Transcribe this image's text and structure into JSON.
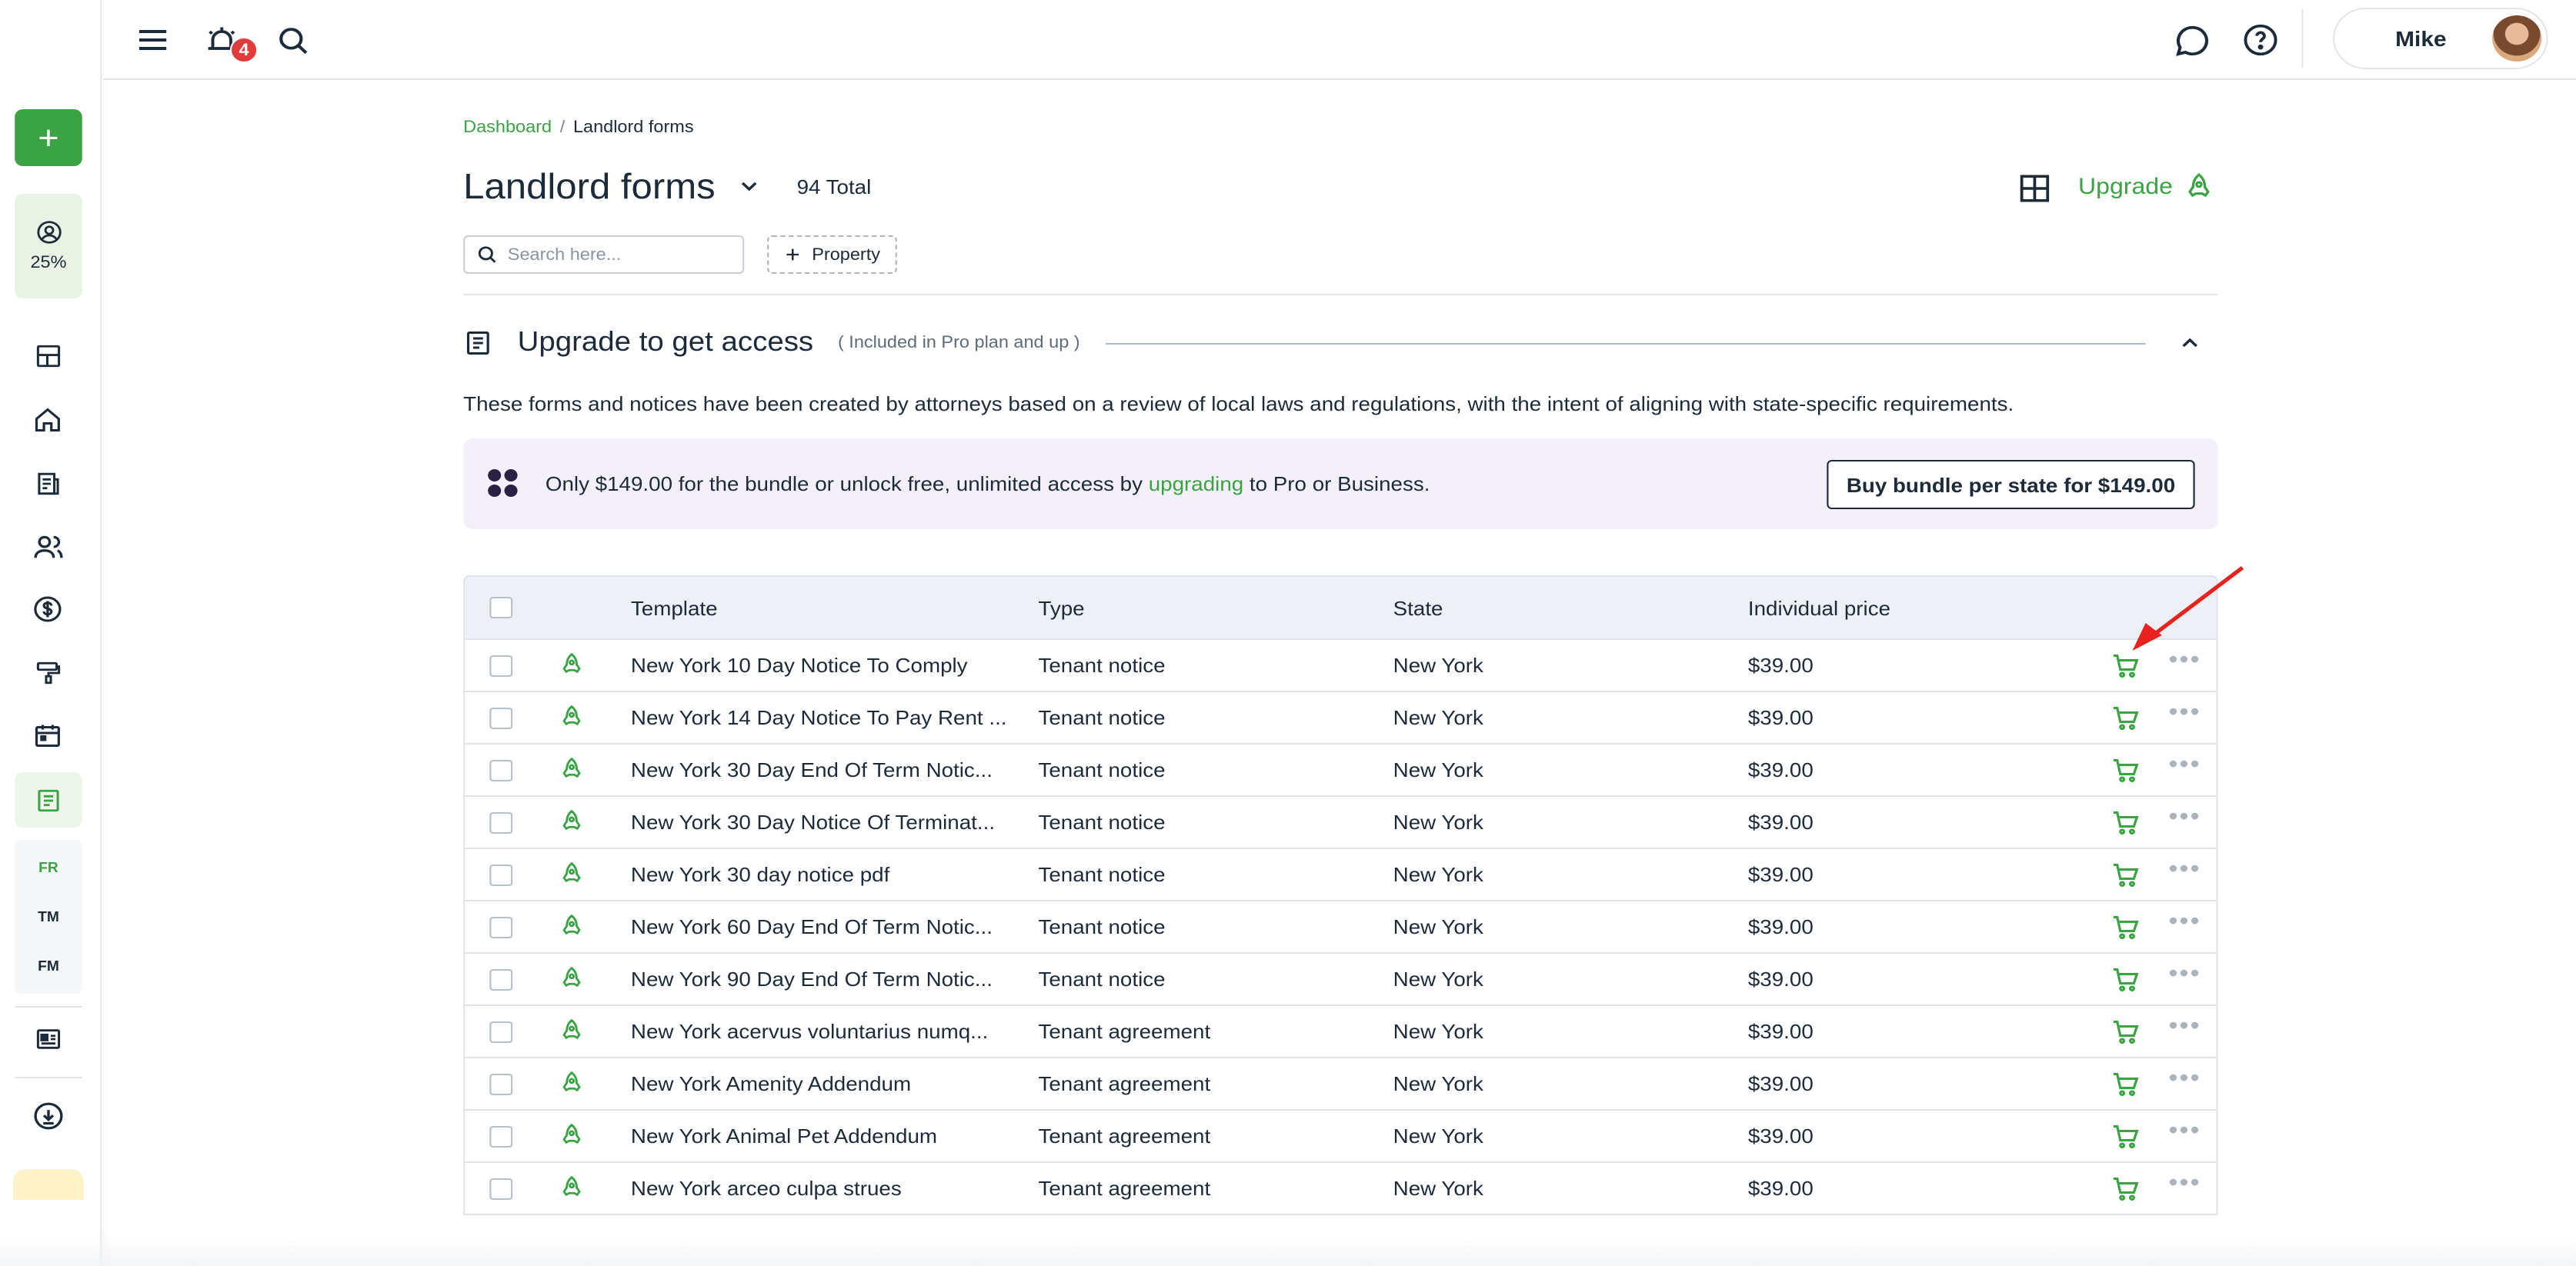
{
  "sidebar": {
    "add_label": "+",
    "progress": "25%",
    "letters": [
      "FR",
      "TM",
      "FM"
    ]
  },
  "topbar": {
    "notification_count": "4",
    "user_name": "Mike"
  },
  "breadcrumb": {
    "home": "Dashboard",
    "sep": "/",
    "current": "Landlord forms"
  },
  "header": {
    "title": "Landlord forms",
    "total": "94 Total",
    "upgrade_label": "Upgrade"
  },
  "filters": {
    "search_placeholder": "Search here...",
    "property_label": "Property"
  },
  "upgrade_section": {
    "title": "Upgrade to get access",
    "subtitle": "( Included in Pro plan and up )",
    "description": "These forms and notices have been created by attorneys based on a review of local laws and regulations, with the intent of aligning with state-specific requirements.",
    "promo_before": "Only $149.00 for the bundle or unlock free, unlimited access by ",
    "promo_link": "upgrading",
    "promo_after": " to Pro or Business.",
    "bundle_button": "Buy bundle per state for $149.00"
  },
  "table": {
    "headers": {
      "template": "Template",
      "type": "Type",
      "state": "State",
      "price": "Individual price"
    },
    "rows": [
      {
        "template": "New York 10 Day Notice To Comply",
        "type": "Tenant notice",
        "state": "New York",
        "price": "$39.00"
      },
      {
        "template": "New York 14 Day Notice To Pay Rent ...",
        "type": "Tenant notice",
        "state": "New York",
        "price": "$39.00"
      },
      {
        "template": "New York 30 Day End Of Term Notic...",
        "type": "Tenant notice",
        "state": "New York",
        "price": "$39.00"
      },
      {
        "template": "New York 30 Day Notice Of Terminat...",
        "type": "Tenant notice",
        "state": "New York",
        "price": "$39.00"
      },
      {
        "template": "New York 30 day notice pdf",
        "type": "Tenant notice",
        "state": "New York",
        "price": "$39.00"
      },
      {
        "template": "New York 60 Day End Of Term Notic...",
        "type": "Tenant notice",
        "state": "New York",
        "price": "$39.00"
      },
      {
        "template": "New York 90 Day End Of Term Notic...",
        "type": "Tenant notice",
        "state": "New York",
        "price": "$39.00"
      },
      {
        "template": "New York acervus voluntarius numq...",
        "type": "Tenant agreement",
        "state": "New York",
        "price": "$39.00"
      },
      {
        "template": "New York Amenity Addendum",
        "type": "Tenant agreement",
        "state": "New York",
        "price": "$39.00"
      },
      {
        "template": "New York Animal Pet Addendum",
        "type": "Tenant agreement",
        "state": "New York",
        "price": "$39.00"
      },
      {
        "template": "New York arceo culpa strues",
        "type": "Tenant agreement",
        "state": "New York",
        "price": "$39.00"
      }
    ]
  },
  "colors": {
    "accent": "#3aa344",
    "text": "#1d2a3a",
    "badge": "#e23b3b",
    "promo_bg": "#f4f0fa",
    "annotation_arrow": "#e8231f"
  },
  "icons": [
    "menu-icon",
    "alarm-bell-icon",
    "search-icon",
    "chat-icon",
    "help-icon",
    "grid-view-icon",
    "rocket-icon",
    "cart-icon",
    "more-icon",
    "chevron-down-icon",
    "chevron-up-icon",
    "document-icon"
  ]
}
